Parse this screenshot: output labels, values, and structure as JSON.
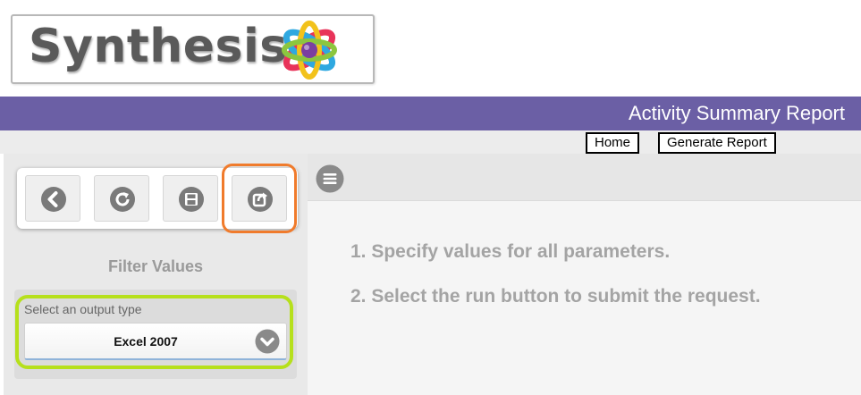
{
  "logo": {
    "text": "Synthesis",
    "mark_icon": "atom-logo-icon"
  },
  "header": {
    "title": "Activity Summary Report",
    "bar_color": "#6b5fa5"
  },
  "nav": {
    "home_label": "Home",
    "generate_label": "Generate Report"
  },
  "toolbar": {
    "buttons": [
      {
        "name": "back-button",
        "icon": "arrow-left-circle-icon"
      },
      {
        "name": "refresh-button",
        "icon": "refresh-icon"
      },
      {
        "name": "save-button",
        "icon": "floppy-disk-icon"
      },
      {
        "name": "export-button",
        "icon": "share-export-icon"
      }
    ],
    "highlight_color": "#f07b2c"
  },
  "filter": {
    "title": "Filter Values",
    "output_label": "Select an output type",
    "output_value": "Excel 2007",
    "highlight_color": "#b6e01c"
  },
  "main": {
    "instructions": [
      "1. Specify values for all parameters.",
      "2. Select the run button to submit the request."
    ]
  }
}
